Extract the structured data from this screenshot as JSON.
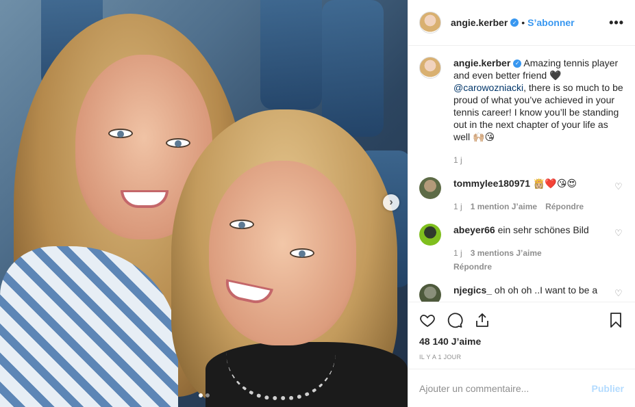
{
  "header": {
    "username": "angie.kerber",
    "separator": "•",
    "follow_label": "S’abonner",
    "more_icon": "more-icon"
  },
  "caption": {
    "username": "angie.kerber",
    "text_1": "Amazing tennis player and even better friend 🖤",
    "mention": "@carowozniacki",
    "text_2": ", there is so much to be proud of what you’ve achieved in your tennis career! I know you’ll be standing out in the next chapter of your life as well 🙌🏼😘",
    "age": "1 j"
  },
  "comments": [
    {
      "username": "tommylee180971",
      "text": "👸🏼❤️😘😍",
      "age": "1 j",
      "likes": "1 mention J’aime",
      "reply": "Répondre"
    },
    {
      "username": "abeyer66",
      "text": "ein sehr schönes Bild",
      "age": "1 j",
      "likes": "3 mentions J’aime",
      "reply": "Répondre"
    },
    {
      "username": "njegics_",
      "text": "oh oh oh ..I want to be a",
      "age": "",
      "likes": "",
      "reply": ""
    }
  ],
  "likes_count": "48 140 J’aime",
  "timestamp": "IL Y A 1 JOUR",
  "add_comment": {
    "placeholder": "Ajouter un commentaire...",
    "publish_label": "Publier"
  },
  "carousel": {
    "current": 1,
    "total": 2
  },
  "colors": {
    "accent": "#3897f0",
    "publish_disabled": "#b3dbff",
    "muted": "#8e8e8e"
  }
}
